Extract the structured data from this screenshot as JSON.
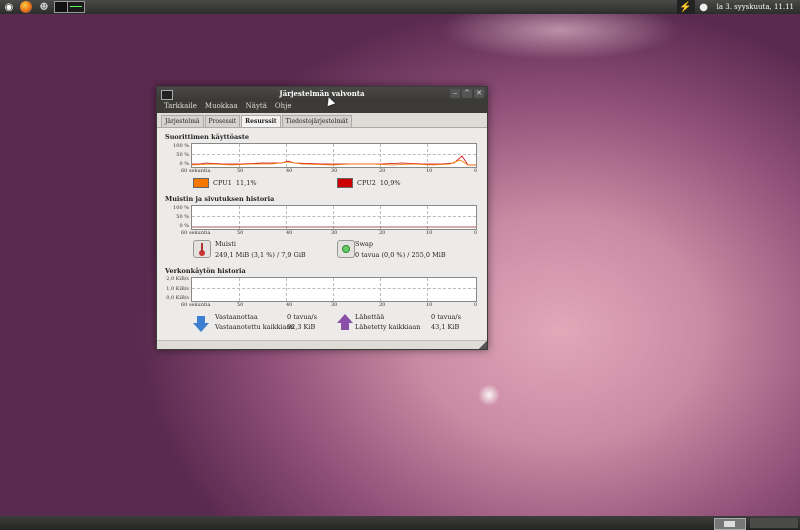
{
  "panel": {
    "launchers": [
      "ubuntu-logo-icon",
      "firefox-icon",
      "gimp-icon",
      "terminal-icon",
      "system-monitor-icon"
    ],
    "tray_icons": [
      "network-icon",
      "user-icon"
    ],
    "clock": "la 3. syyskuuta, 11.11"
  },
  "window": {
    "title": "Järjestelmän valvonta",
    "menus": [
      "Tarkkaile",
      "Muokkaa",
      "Näytä",
      "Ohje"
    ],
    "tabs": [
      "Järjestelmä",
      "Prosessit",
      "Resurssit",
      "Tiedostojärjestelmät"
    ],
    "active_tab": "Resurssit"
  },
  "cpu": {
    "heading": "Suorittimen käyttöaste",
    "y_ticks": [
      "100 %",
      "50 %",
      "0 %"
    ],
    "x_ticks": [
      "60 sekuntia",
      "50",
      "40",
      "30",
      "20",
      "10",
      "0"
    ],
    "cpu1": {
      "label": "CPU1",
      "value": "11,1%",
      "color": "#f57900"
    },
    "cpu2": {
      "label": "CPU2",
      "value": "10,9%",
      "color": "#cc0000"
    }
  },
  "memory": {
    "heading": "Muistin ja sivutuksen historia",
    "y_ticks": [
      "100 %",
      "50 %",
      "0 %"
    ],
    "x_ticks": [
      "60 sekuntia",
      "50",
      "40",
      "30",
      "20",
      "10",
      "0"
    ],
    "memory_label": "Muisti",
    "memory_value": "249,1 MiB (3,1 %) / 7,9 GiB",
    "swap_label": "Swap",
    "swap_value": "0 tavua (0,0 %) / 255,0 MiB"
  },
  "network": {
    "heading": "Verkonkäytön historia",
    "y_ticks": [
      "2,0 KiB/s",
      "1,0 KiB/s",
      "0,0 KiB/s"
    ],
    "x_ticks": [
      "60 sekuntia",
      "50",
      "40",
      "30",
      "20",
      "10",
      "0"
    ],
    "receiving_label": "Vastaanottaa",
    "receiving_value": "0 tavua/s",
    "received_total_label": "Vastaanotettu kaikkiaan",
    "received_total_value": "92,3 KiB",
    "sending_label": "Lähettää",
    "sending_value": "0 tavua/s",
    "sent_total_label": "Lähetetty kaikkiaan",
    "sent_total_value": "43,1 KiB"
  }
}
